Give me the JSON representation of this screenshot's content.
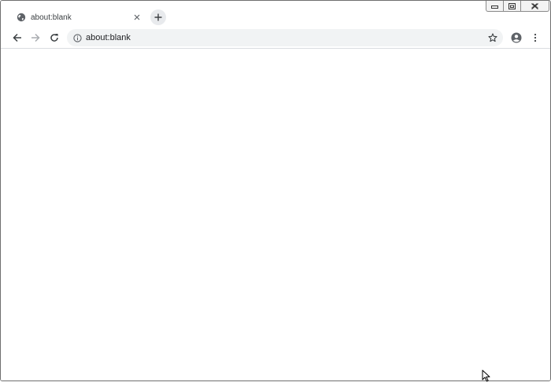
{
  "tab": {
    "title": "about:blank",
    "favicon": "globe-icon",
    "close_icon": "close-icon"
  },
  "newtab": {
    "icon": "plus-icon"
  },
  "window_controls": {
    "minimize": "minimize-icon",
    "restore": "restore-icon",
    "close": "close-icon"
  },
  "toolbar": {
    "back": "arrow-left-icon",
    "forward": "arrow-right-icon",
    "reload": "reload-icon",
    "url": "about:blank",
    "info_icon": "info-icon",
    "bookmark_icon": "star-icon",
    "profile_icon": "account-icon",
    "menu_icon": "kebab-menu-icon"
  },
  "colors": {
    "tab_text": "#3c4043",
    "omnibox_bg": "#f1f3f4",
    "icon": "#5f6368",
    "forward_disabled": "#a9acb0",
    "newtab_bg": "#e8eaed"
  }
}
